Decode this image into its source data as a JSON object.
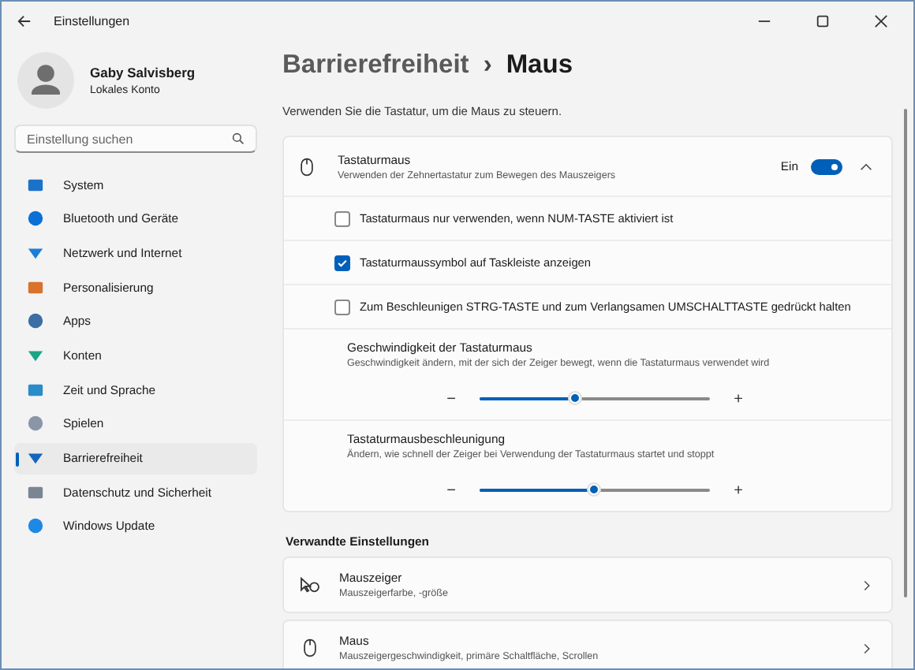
{
  "window": {
    "title": "Einstellungen"
  },
  "profile": {
    "name": "Gaby Salvisberg",
    "account": "Lokales Konto"
  },
  "search": {
    "placeholder": "Einstellung suchen"
  },
  "sidebar": {
    "items": [
      {
        "label": "System",
        "selected": false
      },
      {
        "label": "Bluetooth und Geräte",
        "selected": false
      },
      {
        "label": "Netzwerk und Internet",
        "selected": false
      },
      {
        "label": "Personalisierung",
        "selected": false
      },
      {
        "label": "Apps",
        "selected": false
      },
      {
        "label": "Konten",
        "selected": false
      },
      {
        "label": "Zeit und Sprache",
        "selected": false
      },
      {
        "label": "Spielen",
        "selected": false
      },
      {
        "label": "Barrierefreiheit",
        "selected": true
      },
      {
        "label": "Datenschutz und Sicherheit",
        "selected": false
      },
      {
        "label": "Windows Update",
        "selected": false
      }
    ]
  },
  "breadcrumb": {
    "parent": "Barrierefreiheit",
    "separator": "›",
    "current": "Maus"
  },
  "subtitle": "Verwenden Sie die Tastatur, um die Maus zu steuern.",
  "mouse_keys": {
    "title": "Tastaturmaus",
    "description": "Verwenden der Zehnertastatur zum Bewegen des Mauszeigers",
    "state_label": "Ein",
    "on": true,
    "expanded": true,
    "options": [
      {
        "kind": "checkbox",
        "label": "Tastaturmaus nur verwenden, wenn NUM-TASTE aktiviert ist",
        "checked": false
      },
      {
        "kind": "checkbox",
        "label": "Tastaturmaussymbol auf Taskleiste anzeigen",
        "checked": true
      },
      {
        "kind": "checkbox",
        "label": "Zum Beschleunigen STRG-TASTE und zum Verlangsamen UMSCHALTTASTE gedrückt halten",
        "checked": false
      },
      {
        "kind": "slider",
        "label": "Geschwindigkeit der Tastaturmaus",
        "description": "Geschwindigkeit ändern, mit der sich der Zeiger bewegt, wenn die Tastaturmaus verwendet wird",
        "minus": "−",
        "plus": "+",
        "level": 0.42
      },
      {
        "kind": "slider",
        "label": "Tastaturmausbeschleunigung",
        "description": "Ändern, wie schnell der Zeiger bei Verwendung der Tastaturmaus startet und stoppt",
        "minus": "−",
        "plus": "+",
        "level": 0.5
      }
    ]
  },
  "related": {
    "heading": "Verwandte Einstellungen",
    "items": [
      {
        "kind": "pointer",
        "title": "Mauszeiger",
        "description": "Mauszeigerfarbe, -größe"
      },
      {
        "kind": "mouse",
        "title": "Maus",
        "description": "Mauszeigergeschwindigkeit, primäre Schaltfläche, Scrollen"
      }
    ]
  }
}
